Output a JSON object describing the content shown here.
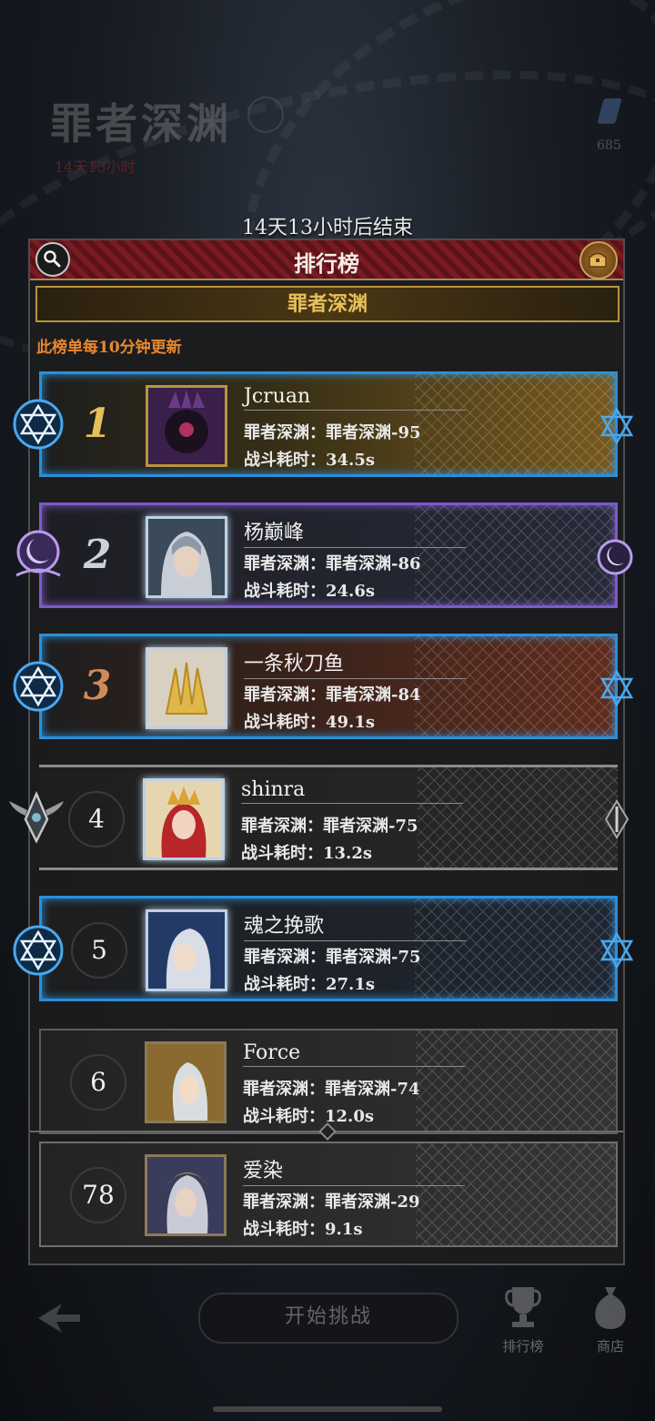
{
  "background": {
    "title": "罪者深渊",
    "subtitle": "14天13小时",
    "gem_count": "685"
  },
  "timer_text": "14天13小时后结束",
  "panel": {
    "title": "排行榜",
    "banner": "罪者深渊",
    "note": "此榜单每10分钟更新"
  },
  "rows": [
    {
      "rank": "1",
      "name": "Jcruan",
      "line1": "罪者深渊：罪者深渊-95",
      "line2": "战斗耗时：34.5s"
    },
    {
      "rank": "2",
      "name": "杨巅峰",
      "line1": "罪者深渊：罪者深渊-86",
      "line2": "战斗耗时：24.6s"
    },
    {
      "rank": "3",
      "name": "一条秋刀鱼",
      "line1": "罪者深渊：罪者深渊-84",
      "line2": "战斗耗时：49.1s"
    },
    {
      "rank": "4",
      "name": "shinra",
      "line1": "罪者深渊：罪者深渊-75",
      "line2": "战斗耗时：13.2s"
    },
    {
      "rank": "5",
      "name": "魂之挽歌",
      "line1": "罪者深渊：罪者深渊-75",
      "line2": "战斗耗时：27.1s"
    },
    {
      "rank": "6",
      "name": "Force",
      "line1": "罪者深渊：罪者深渊-74",
      "line2": "战斗耗时：12.0s"
    }
  ],
  "self_row": {
    "rank": "78",
    "name": "爱染",
    "line1": "罪者深渊：罪者深渊-29",
    "line2": "战斗耗时：9.1s"
  },
  "bottom": {
    "start_label": "开始挑战",
    "nav_rank_label": "排行榜",
    "nav_shop_label": "商店"
  },
  "colors": {
    "accent_gold": "#e6c15a",
    "header_red": "#7a1b22",
    "note_orange": "#e8882c",
    "frame_blue": "#2a8fd9",
    "frame_purple": "#7c5bc9"
  }
}
